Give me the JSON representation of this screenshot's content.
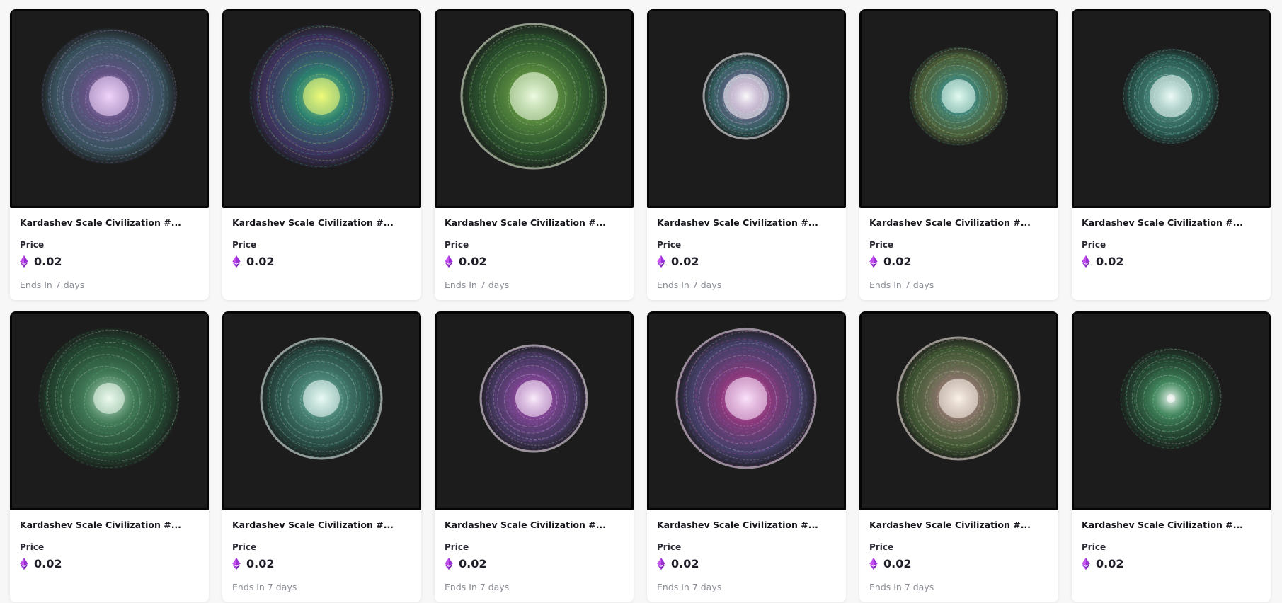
{
  "listing": {
    "cards": [
      {
        "title": "Kardashev Scale Civilization #...",
        "price_label": "Price",
        "price": "0.02",
        "ends": "Ends In 7 days",
        "art_colors": [
          "#f6d9ff",
          "#9b7bd6",
          "#6fb6d8"
        ]
      },
      {
        "title": "Kardashev Scale Civilization #...",
        "price_label": "Price",
        "price": "0.02",
        "ends": "",
        "art_colors": [
          "#f5ff7a",
          "#39d0b0",
          "#7a5bd6"
        ]
      },
      {
        "title": "Kardashev Scale Civilization #...",
        "price_label": "Price",
        "price": "0.02",
        "ends": "Ends In 7 days",
        "art_colors": [
          "#f2ffe6",
          "#88e05a",
          "#3fa54a"
        ]
      },
      {
        "title": "Kardashev Scale Civilization #...",
        "price_label": "Price",
        "price": "0.02",
        "ends": "Ends In 7 days",
        "art_colors": [
          "#ffffff",
          "#c995f2",
          "#5fd4d8"
        ]
      },
      {
        "title": "Kardashev Scale Civilization #...",
        "price_label": "Price",
        "price": "0.02",
        "ends": "Ends In 7 days",
        "art_colors": [
          "#e9fff6",
          "#5ed8c3",
          "#9fd36a"
        ]
      },
      {
        "title": "Kardashev Scale Civilization #...",
        "price_label": "Price",
        "price": "0.02",
        "ends": "",
        "art_colors": [
          "#f4fffb",
          "#7fe8d6",
          "#3bbba4"
        ]
      },
      {
        "title": "Kardashev Scale Civilization #...",
        "price_label": "Price",
        "price": "0.02",
        "ends": "",
        "art_colors": [
          "#f3fff4",
          "#63c98a",
          "#2f8f54"
        ]
      },
      {
        "title": "Kardashev Scale Civilization #...",
        "price_label": "Price",
        "price": "0.02",
        "ends": "Ends In 7 days",
        "art_colors": [
          "#f0fffb",
          "#6fd8c0",
          "#3f9f8a"
        ]
      },
      {
        "title": "Kardashev Scale Civilization #...",
        "price_label": "Price",
        "price": "0.02",
        "ends": "Ends In 7 days",
        "art_colors": [
          "#fff2ff",
          "#d063f0",
          "#8a6bd6"
        ]
      },
      {
        "title": "Kardashev Scale Civilization #...",
        "price_label": "Price",
        "price": "0.02",
        "ends": "Ends In 7 days",
        "art_colors": [
          "#ffe8ff",
          "#e44fc8",
          "#8d7ff0"
        ]
      },
      {
        "title": "Kardashev Scale Civilization #...",
        "price_label": "Price",
        "price": "0.02",
        "ends": "Ends In 7 days",
        "art_colors": [
          "#fff6ec",
          "#d9b8a3",
          "#7fbf5c"
        ]
      },
      {
        "title": "Kardashev Scale Civilization #...",
        "price_label": "Price",
        "price": "0.02",
        "ends": "",
        "art_colors": [
          "#ffffff",
          "#5fd88f",
          "#2b7a4a"
        ]
      }
    ],
    "currency_icon": "ethereum-icon",
    "currency_color": "#9b2fd6"
  }
}
